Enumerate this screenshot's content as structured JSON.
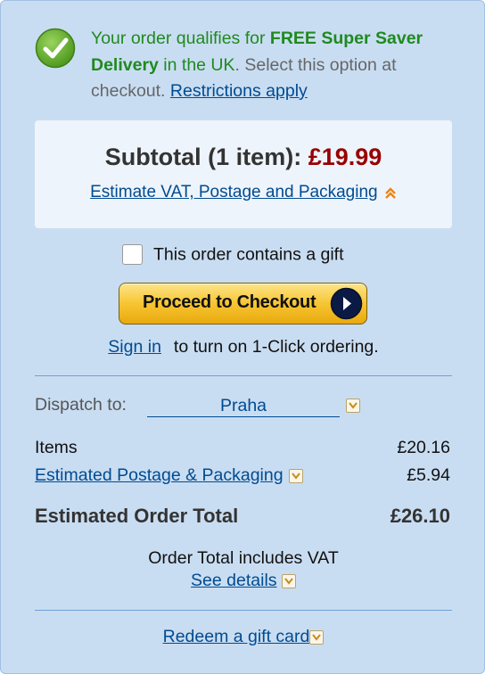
{
  "delivery": {
    "part1": "Your order qualifies for ",
    "part2": "FREE Super Saver Delivery",
    "part3": " in the UK",
    "part4": ". Select this option at checkout. ",
    "restrictions": "Restrictions apply"
  },
  "subtotal": {
    "label": "Subtotal (1 item):",
    "price": "£19.99",
    "estimate_link": "Estimate VAT, Postage and Packaging"
  },
  "gift": {
    "label": "This order contains a gift",
    "checked": false
  },
  "checkout": {
    "label": "Proceed to Checkout"
  },
  "signin": {
    "link": "Sign in",
    "text": "to turn on 1-Click ordering."
  },
  "dispatch": {
    "label": "Dispatch to:",
    "city": "Praha"
  },
  "lines": {
    "items_label": "Items",
    "items_amount": "£20.16",
    "postage_label": "Estimated Postage & Packaging",
    "postage_amount": "£5.94"
  },
  "total": {
    "label": "Estimated Order Total",
    "amount": "£26.10"
  },
  "vat": {
    "text": "Order Total includes VAT",
    "details": "See details"
  },
  "redeem": {
    "label": "Redeem a gift card"
  },
  "colors": {
    "panel": "#c9ddf2",
    "link": "#004b91",
    "price": "#990000",
    "free": "#1f8a1f",
    "button": "#f7c531"
  }
}
